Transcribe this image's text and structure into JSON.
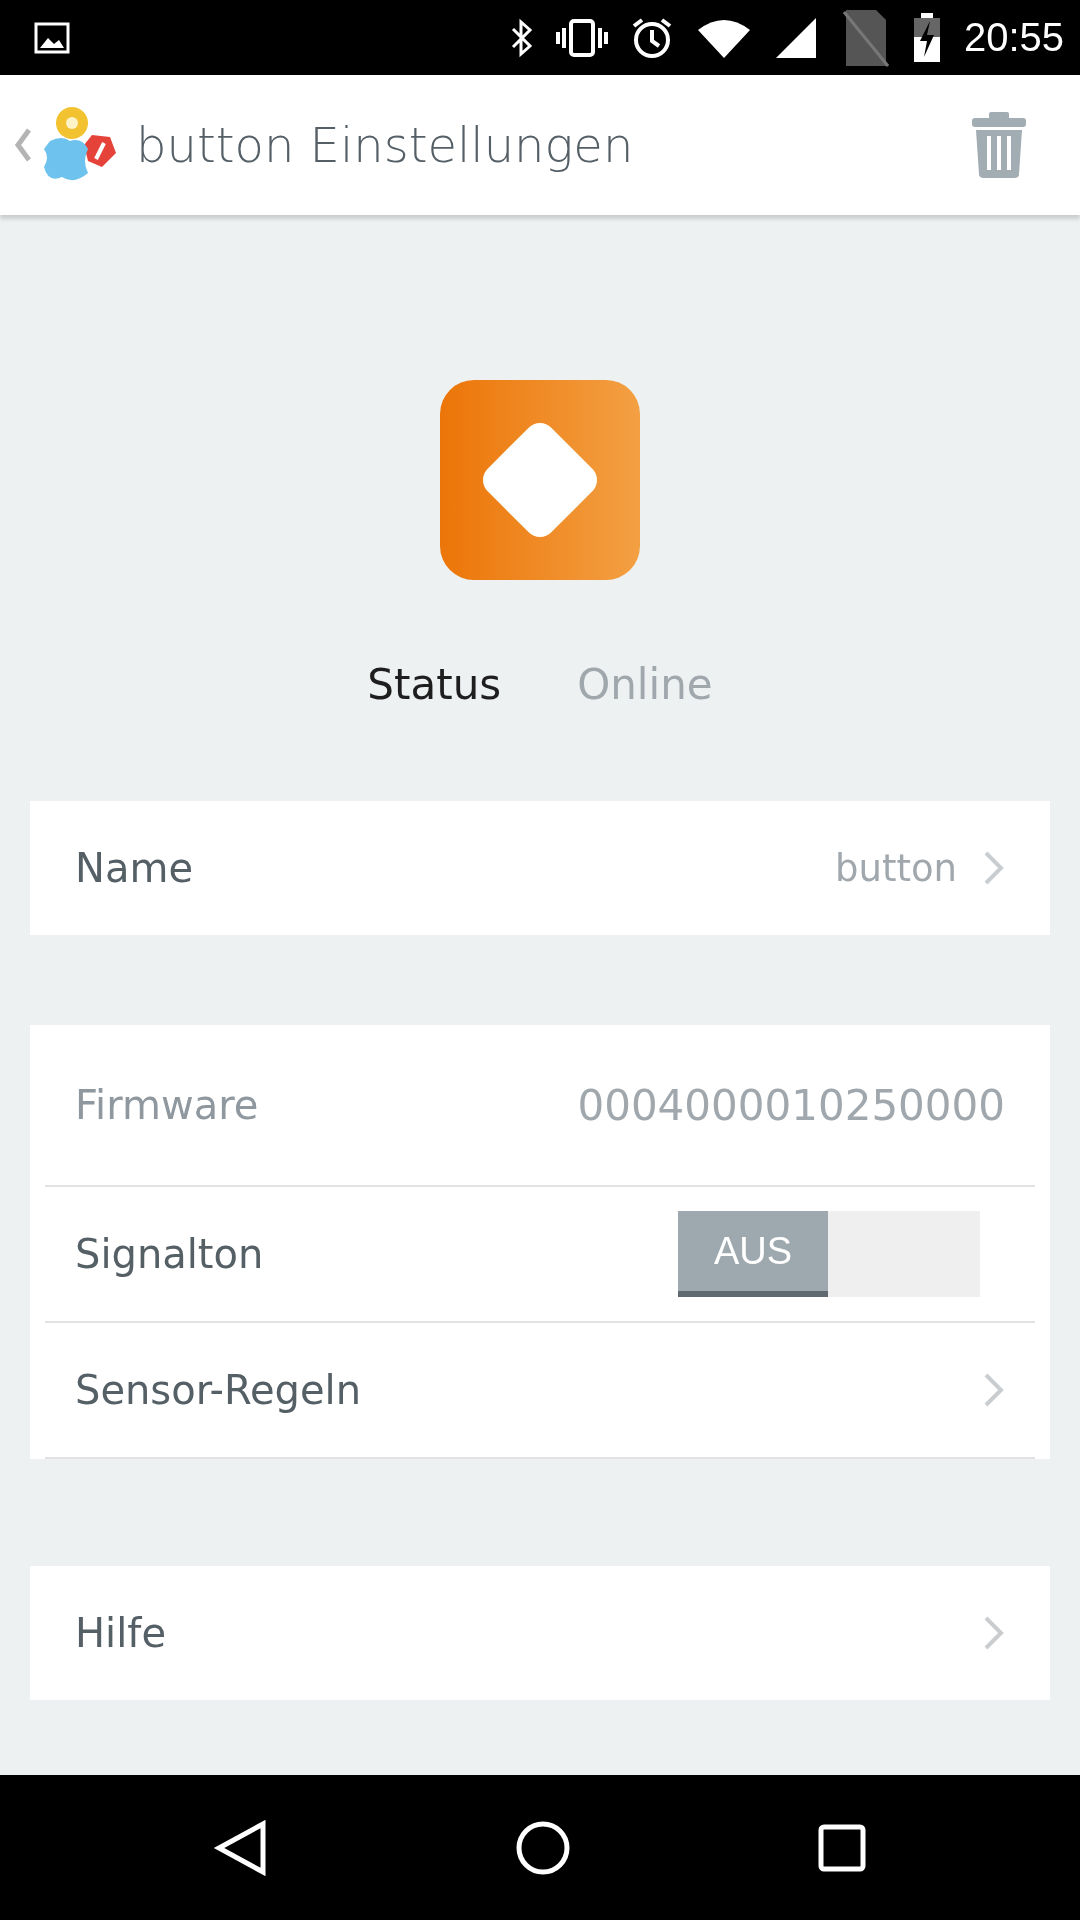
{
  "status_bar": {
    "time": "20:55"
  },
  "app_bar": {
    "title": "button Einstellungen"
  },
  "device": {
    "status_label": "Status",
    "status_value": "Online"
  },
  "sections": [
    {
      "rows": [
        {
          "kind": "link",
          "label": "Name",
          "value": "button"
        }
      ]
    },
    {
      "rows": [
        {
          "kind": "info",
          "label": "Firmware",
          "value": "0004000010250000"
        },
        {
          "kind": "toggle",
          "label": "Signalton",
          "on": false,
          "state_text": "AUS"
        },
        {
          "kind": "link",
          "label": "Sensor-Regeln"
        }
      ]
    },
    {
      "rows": [
        {
          "kind": "link",
          "label": "Hilfe"
        }
      ]
    }
  ]
}
